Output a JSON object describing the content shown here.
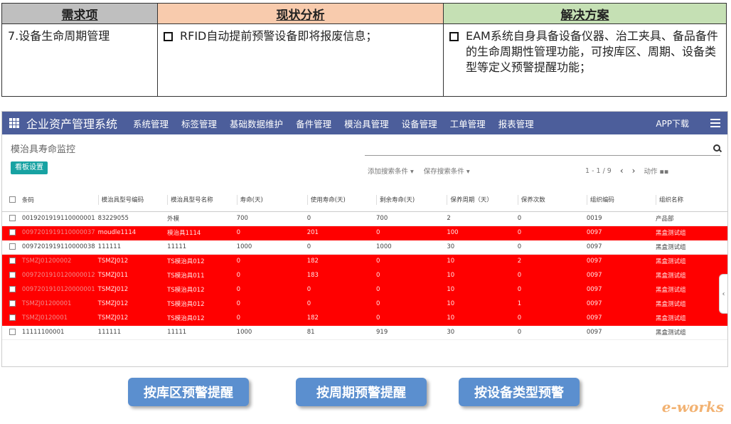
{
  "requirement_table": {
    "headers": [
      "需求项",
      "现状分析",
      "解决方案"
    ],
    "item": "7.设备生命周期管理",
    "analysis": "RFID自动提前预警设备即将报废信息；",
    "solution": "EAM系统自身具备设备仪器、治工夹具、备品备件的生命周期性管理功能，可按库区、周期、设备类型等定义预警提醒功能；"
  },
  "navbar": {
    "app_title": "企业资产管理系统",
    "items": [
      "系统管理",
      "标签管理",
      "基础数据维护",
      "备件管理",
      "模治具管理",
      "设备管理",
      "工单管理",
      "报表管理"
    ],
    "app_download": "APP下载"
  },
  "page": {
    "title": "模治具寿命监控",
    "kanban_button": "看板设置",
    "add_filter": "添加搜索条件 ▾",
    "save_filter": "保存搜索条件 ▾",
    "pager": "1 - 1 / 9",
    "action": "动作 ▪▪"
  },
  "table": {
    "columns": [
      "条码",
      "模治具型号编码",
      "模治具型号名称",
      "寿命(天)",
      "使用寿命(天)",
      "剩余寿命(天)",
      "保养周期（天）",
      "保养次数",
      "组织编码",
      "组织名称"
    ],
    "rows": [
      {
        "alert": false,
        "cells": [
          "0019201919110000001",
          "83229055",
          "外模",
          "700",
          "0",
          "700",
          "2",
          "0",
          "0019",
          "产品部"
        ]
      },
      {
        "alert": true,
        "cells": [
          "0097201919110000037",
          "moudle1114",
          "模治具1114",
          "0",
          "201",
          "0",
          "100",
          "0",
          "0097",
          "黑盒测试组"
        ]
      },
      {
        "alert": false,
        "cells": [
          "0097201919110000038",
          "111111",
          "11111",
          "1000",
          "0",
          "1000",
          "30",
          "0",
          "0097",
          "黑盒测试组"
        ]
      },
      {
        "alert": true,
        "cells": [
          "TSMZJ01200002",
          "TSMZJ012",
          "TS模治具012",
          "0",
          "182",
          "0",
          "10",
          "2",
          "0097",
          "黑盒测试组"
        ]
      },
      {
        "alert": true,
        "cells": [
          "0097201910120000012",
          "TSMZJ011",
          "TS模治具011",
          "0",
          "183",
          "0",
          "10",
          "0",
          "0097",
          "黑盒测试组"
        ]
      },
      {
        "alert": true,
        "cells": [
          "0097201910120000001",
          "TSMZJ012",
          "TS模治具012",
          "0",
          "0",
          "0",
          "10",
          "0",
          "0097",
          "黑盒测试组"
        ]
      },
      {
        "alert": true,
        "cells": [
          "TSMZJ01200001",
          "TSMZJ012",
          "TS模治具012",
          "0",
          "0",
          "0",
          "10",
          "1",
          "0097",
          "黑盒测试组"
        ]
      },
      {
        "alert": true,
        "cells": [
          "TSMZJ0120001",
          "TSMZJ012",
          "TS模治具012",
          "0",
          "182",
          "0",
          "10",
          "0",
          "0097",
          "黑盒测试组"
        ]
      },
      {
        "alert": false,
        "cells": [
          "11111100001",
          "111111",
          "11111",
          "1000",
          "81",
          "919",
          "30",
          "0",
          "0097",
          "黑盒测试组"
        ]
      }
    ]
  },
  "buttons": [
    "按库区预警提醒",
    "按周期预警提醒",
    "按设备类型预警"
  ],
  "watermark": "e-works",
  "colors": {
    "navbar": "#4c5e9b",
    "alert_row": "#ff0000",
    "action_button": "#5b8fcf",
    "kanban_button": "#17a2a2"
  }
}
